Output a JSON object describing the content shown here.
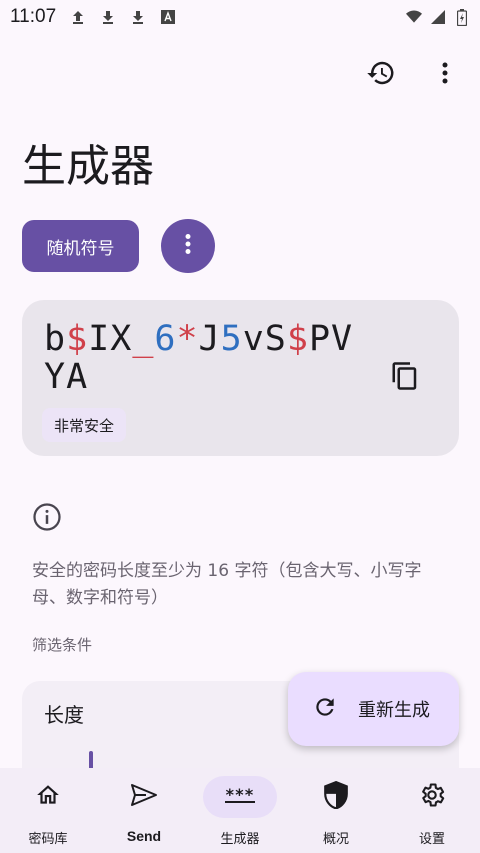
{
  "status_bar": {
    "time": "11:07",
    "left_icons": [
      "upload-icon",
      "download-icon",
      "download-icon",
      "font-icon"
    ],
    "right_icons": [
      "wifi-icon",
      "signal-icon",
      "battery-icon"
    ]
  },
  "top_actions": {
    "history_icon": "history-icon",
    "more_icon": "more-vert-icon"
  },
  "page": {
    "title": "生成器"
  },
  "generator": {
    "type_label": "随机符号",
    "password_parts": [
      {
        "t": "b",
        "k": "c"
      },
      {
        "t": "$",
        "k": "s"
      },
      {
        "t": "IX",
        "k": "c"
      },
      {
        "t": "_",
        "k": "s"
      },
      {
        "t": "6",
        "k": "n"
      },
      {
        "t": "*",
        "k": "s"
      },
      {
        "t": "J",
        "k": "c"
      },
      {
        "t": "5",
        "k": "n"
      },
      {
        "t": "vS",
        "k": "c"
      },
      {
        "t": "$",
        "k": "s"
      },
      {
        "t": "PVYA",
        "k": "c"
      }
    ],
    "strength": "非常安全",
    "hint": "安全的密码长度至少为 16 字符（包含大写、小写字母、数字和符号）",
    "filter_label": "筛选条件",
    "length_title": "长度",
    "regenerate_label": "重新生成"
  },
  "colors": {
    "accent": "#6750a4",
    "symbol": "#d0404a",
    "number": "#2f6fc0"
  },
  "nav": {
    "items": [
      {
        "label": "密码库",
        "icon": "home-icon"
      },
      {
        "label": "Send",
        "icon": "send-icon"
      },
      {
        "label": "生成器",
        "icon": "password-icon"
      },
      {
        "label": "概况",
        "icon": "shield-icon"
      },
      {
        "label": "设置",
        "icon": "gear-icon"
      }
    ],
    "active": "生成器"
  }
}
